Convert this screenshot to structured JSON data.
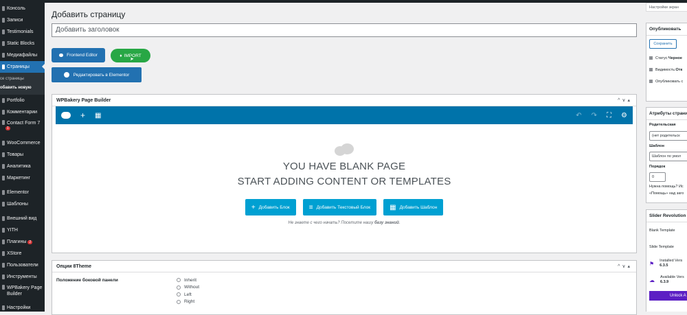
{
  "sidebar": {
    "items": [
      {
        "label": "Консоль"
      },
      {
        "label": "Записи"
      },
      {
        "label": "Testimonials"
      },
      {
        "label": "Static Blocks"
      },
      {
        "label": "Медиафайлы"
      },
      {
        "label": "Страницы",
        "active": true
      },
      {
        "label": "Portfolio"
      },
      {
        "label": "Комментарии"
      },
      {
        "label": "Contact Form 7",
        "badge": "1"
      },
      {
        "label": "WooCommerce"
      },
      {
        "label": "Товары"
      },
      {
        "label": "Аналитика"
      },
      {
        "label": "Маркетинг"
      },
      {
        "label": "Elementor"
      },
      {
        "label": "Шаблоны"
      },
      {
        "label": "Внешний вид"
      },
      {
        "label": "YITH"
      },
      {
        "label": "Плагины",
        "badge": "2"
      },
      {
        "label": "XStore"
      },
      {
        "label": "Пользователи"
      },
      {
        "label": "Инструменты"
      },
      {
        "label": "WPBakery Page Builder"
      },
      {
        "label": "Настройки"
      }
    ],
    "submenu": [
      "се страницы",
      "обавить новую"
    ]
  },
  "page": {
    "title": "Добавить страницу",
    "title_placeholder": "Добавить заголовок"
  },
  "toolbar": {
    "frontend": "Frontend Editor",
    "import": "IMPORT",
    "elementor": "Редактировать в Elementor"
  },
  "wpb": {
    "title": "WPBakery Page Builder",
    "blank_line1": "YOU HAVE BLANK PAGE",
    "blank_line2": "START ADDING CONTENT OR TEMPLATES",
    "add_block": "Добавить Блок",
    "add_text": "Добавить Текстовый Блок",
    "add_template": "Добавить Шаблон",
    "hint_prefix": "Не знаете с чего начать? Посетите нашу ",
    "hint_link": "базу знаний",
    "hint_suffix": "."
  },
  "options": {
    "title": "Опции 8Theme",
    "sidebar_label": "Положение боковой панели",
    "choices": [
      "Inherit",
      "Without",
      "Left",
      "Right"
    ]
  },
  "right": {
    "screen_options": "Настройки экран",
    "publish": {
      "title": "Опубликовать",
      "save": "Сохранить",
      "status_label": "Статус: ",
      "status_value": "Черное",
      "visibility_label": "Видимость: ",
      "visibility_value": "Отк",
      "publish_label": "Опубликовать с"
    },
    "attrs": {
      "title": "Атрибуты страни",
      "parent_label": "Родительская",
      "parent_value": "(нет родительск",
      "template_label": "Шаблон",
      "template_value": "Шаблон по умол",
      "order_label": "Порядок",
      "order_value": "0",
      "help_line1": "Нужна помощь? Ис",
      "help_line2": "«Помощь» над заго"
    },
    "slider": {
      "title": "Slider Revolution",
      "blank_template": "Blank Template",
      "slide_template": "Slide Template",
      "installed_label": "Installed Vers",
      "installed_value": "6.3.5",
      "available_label": "Available Vers",
      "available_value": "6.3.9",
      "unlock": "Unlock A"
    }
  },
  "colors": {
    "admin_blue": "#2271b1",
    "wpb_blue": "#0073aa",
    "action_blue": "#00a0d2",
    "import_green": "#28a745",
    "sidebar_dark": "#1d2327",
    "unlock_purple": "#5c1fc4"
  }
}
